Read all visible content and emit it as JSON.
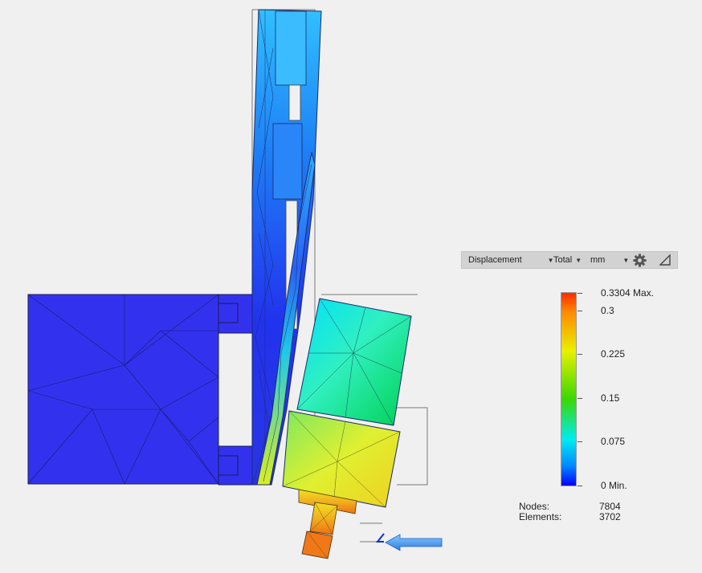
{
  "toolbar": {
    "result_type": "Displacement",
    "component": "Total",
    "unit": "mm"
  },
  "legend": {
    "max_label": "0.3304 Max.",
    "ticks": [
      "0.3",
      "0.225",
      "0.15",
      "0.075"
    ],
    "min_label": "0 Min."
  },
  "stats": {
    "nodes_label": "Nodes:",
    "nodes_value": "7804",
    "elements_label": "Elements:",
    "elements_value": "3702"
  },
  "colors": {
    "max": "#ff2a00",
    "mid": "#e8f000",
    "min": "#0000ff",
    "load_arrow": "#3a8ee8",
    "background": "#f0f0f0"
  },
  "icons": [
    "gear-icon",
    "triangle-icon",
    "load-arrow-icon",
    "constraint-hook-icon"
  ]
}
